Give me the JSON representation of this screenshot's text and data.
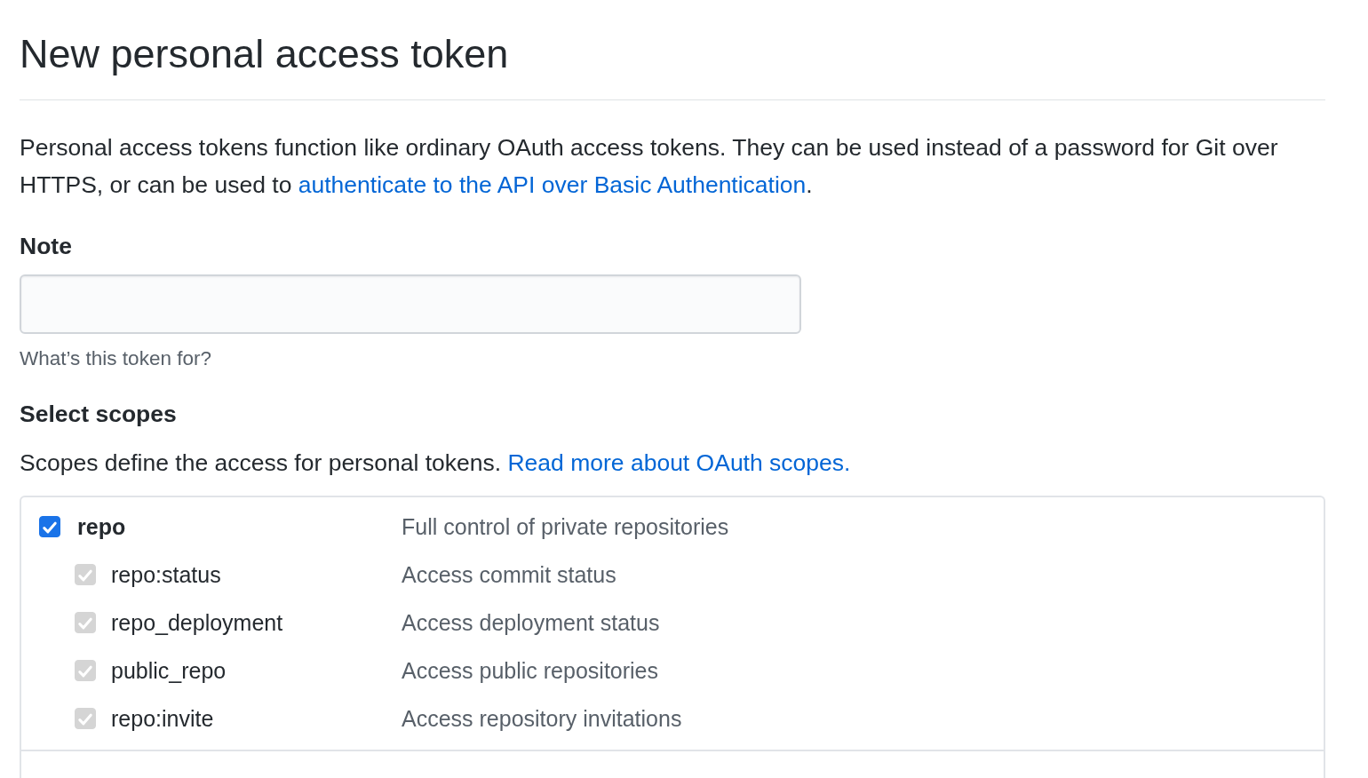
{
  "page_title": "New personal access token",
  "intro": {
    "text": "Personal access tokens function like ordinary OAuth access tokens. They can be used instead of a password for Git over HTTPS, or can be used to ",
    "link": "authenticate to the API over Basic Authentication",
    "after": "."
  },
  "note": {
    "label": "Note",
    "hint": "What’s this token for?"
  },
  "scopes_section": {
    "heading": "Select scopes",
    "text": "Scopes define the access for personal tokens. ",
    "link": "Read more about OAuth scopes."
  },
  "scopes": [
    {
      "name": "repo",
      "description": "Full control of private repositories",
      "checked": true,
      "disabled": false,
      "children": [
        {
          "name": "repo:status",
          "description": "Access commit status",
          "checked": true,
          "disabled": true
        },
        {
          "name": "repo_deployment",
          "description": "Access deployment status",
          "checked": true,
          "disabled": true
        },
        {
          "name": "public_repo",
          "description": "Access public repositories",
          "checked": true,
          "disabled": true
        },
        {
          "name": "repo:invite",
          "description": "Access repository invitations",
          "checked": true,
          "disabled": true
        }
      ]
    }
  ]
}
